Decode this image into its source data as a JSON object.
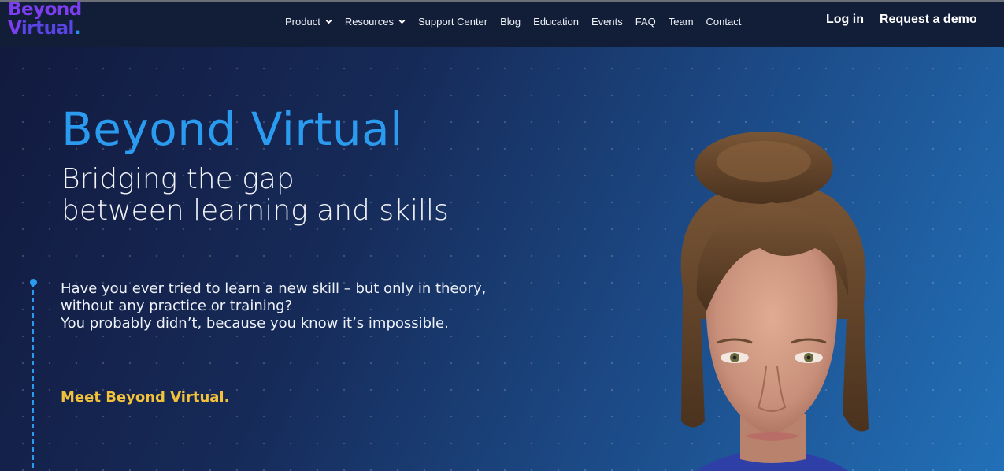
{
  "brand": {
    "logo_line1": "Beyond",
    "logo_line2_v": "V",
    "logo_line2_rest": "irtual",
    "logo_dot": "."
  },
  "nav": {
    "items": [
      {
        "label": "Product",
        "has_dropdown": true
      },
      {
        "label": "Resources",
        "has_dropdown": true
      },
      {
        "label": "Support Center",
        "has_dropdown": false
      },
      {
        "label": "Blog",
        "has_dropdown": false
      },
      {
        "label": "Education",
        "has_dropdown": false
      },
      {
        "label": "Events",
        "has_dropdown": false
      },
      {
        "label": "FAQ",
        "has_dropdown": false
      },
      {
        "label": "Team",
        "has_dropdown": false
      },
      {
        "label": "Contact",
        "has_dropdown": false
      }
    ],
    "login_label": "Log in",
    "demo_label": "Request a demo"
  },
  "hero": {
    "title": "Beyond Virtual",
    "subtitle_line1": "Bridging the gap",
    "subtitle_line2": "between learning and skills",
    "body_line1": "Have you ever tried to learn a new skill – but only in theory,",
    "body_line2": "without any practice or training?",
    "body_line3": "You probably didn’t, because you know it’s impossible.",
    "cta_text": "Meet Beyond Virtual."
  },
  "colors": {
    "accent_blue": "#2b9bf0",
    "brand_purple": "#7d3df0",
    "cta_yellow": "#f4c23a",
    "nav_bg": "#121e38"
  }
}
